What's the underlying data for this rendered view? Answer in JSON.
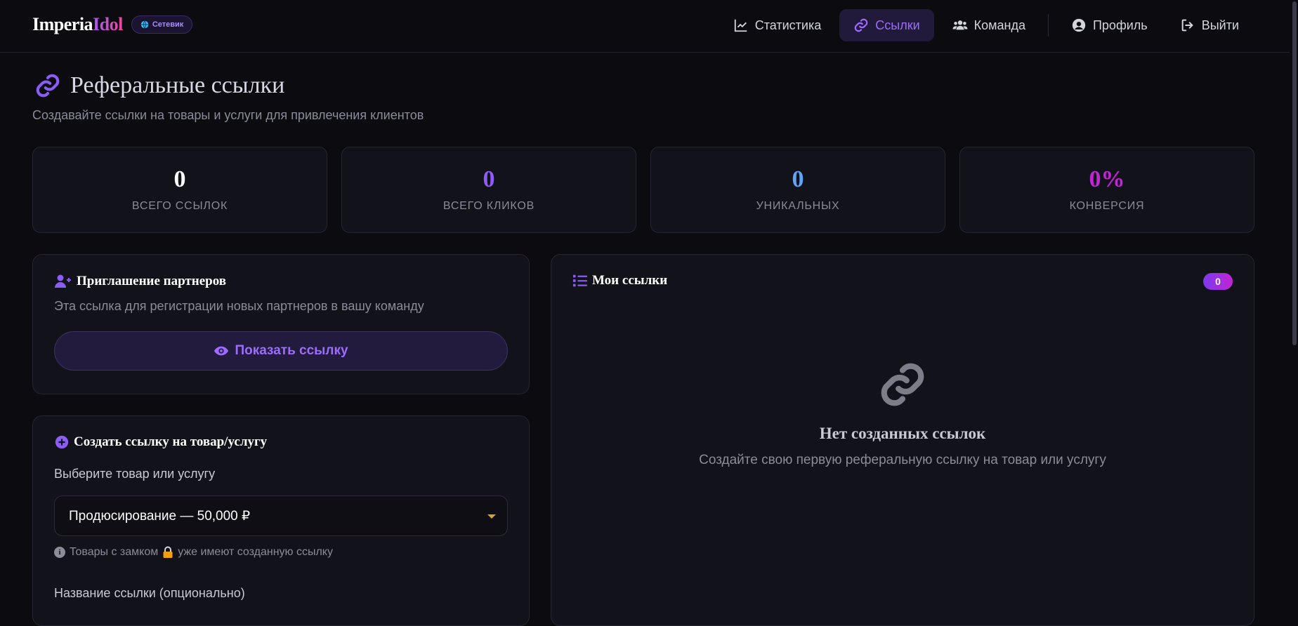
{
  "header": {
    "brand_part1": "Imperia",
    "brand_part2": "Idol",
    "role_badge": "Сетевик",
    "nav": {
      "stats": "Статистика",
      "links": "Ссылки",
      "team": "Команда",
      "profile": "Профиль",
      "logout": "Выйти"
    }
  },
  "page": {
    "title": "Реферальные ссылки",
    "subtitle": "Создавайте ссылки на товары и услуги для привлечения клиентов"
  },
  "stats": [
    {
      "value": "0",
      "label": "ВСЕГО ССЫЛОК",
      "color": "#ffffff"
    },
    {
      "value": "0",
      "label": "ВСЕГО КЛИКОВ",
      "color": "#8b5cf6"
    },
    {
      "value": "0",
      "label": "УНИКАЛЬНЫХ",
      "color": "#60a5fa"
    },
    {
      "value": "0%",
      "label": "КОНВЕРСИЯ",
      "color": "#c026d3"
    }
  ],
  "invite": {
    "title": "Приглашение партнеров",
    "text": "Эта ссылка для регистрации новых партнеров в вашу команду",
    "button": "Показать ссылку"
  },
  "create": {
    "title": "Создать ссылку на товар/услугу",
    "select_label": "Выберите товар или услугу",
    "selected_option": "Продюсирование — 50,000 ₽",
    "hint_before": "Товары с замком",
    "hint_after": "уже имеют созданную ссылку",
    "name_label": "Название ссылки (опционально)"
  },
  "my_links": {
    "title": "Мои ссылки",
    "count": "0",
    "empty_title": "Нет созданных ссылок",
    "empty_text": "Создайте свою первую реферальную ссылку на товар или услугу"
  },
  "colors": {
    "accent": "#8b5cf6",
    "background": "#0b0b10",
    "card": "#12121a"
  }
}
